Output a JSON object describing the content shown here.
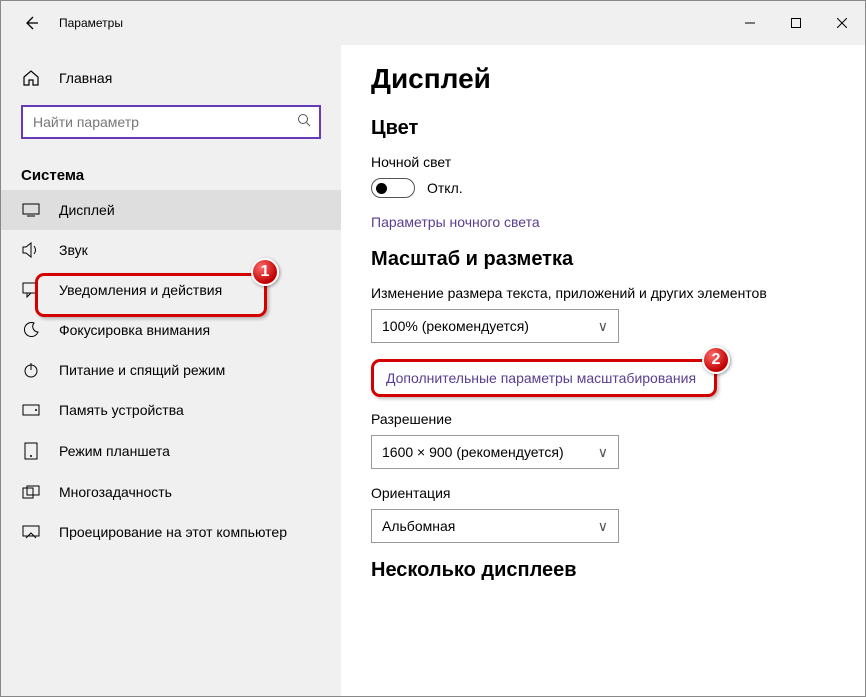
{
  "titlebar": {
    "title": "Параметры"
  },
  "sidebar": {
    "home": "Главная",
    "search_placeholder": "Найти параметр",
    "section": "Система",
    "items": [
      {
        "label": "Дисплей"
      },
      {
        "label": "Звук"
      },
      {
        "label": "Уведомления и действия"
      },
      {
        "label": "Фокусировка внимания"
      },
      {
        "label": "Питание и спящий режим"
      },
      {
        "label": "Память устройства"
      },
      {
        "label": "Режим планшета"
      },
      {
        "label": "Многозадачность"
      },
      {
        "label": "Проецирование на этот компьютер"
      }
    ]
  },
  "main": {
    "heading": "Дисплей",
    "color_heading": "Цвет",
    "night_light_label": "Ночной свет",
    "night_light_state": "Откл.",
    "night_light_link": "Параметры ночного света",
    "scale_heading": "Масштаб и разметка",
    "scale_label": "Изменение размера текста, приложений и других элементов",
    "scale_value": "100% (рекомендуется)",
    "advanced_scaling_link": "Дополнительные параметры масштабирования",
    "resolution_label": "Разрешение",
    "resolution_value": "1600 × 900 (рекомендуется)",
    "orientation_label": "Ориентация",
    "orientation_value": "Альбомная",
    "multi_heading": "Несколько дисплеев"
  },
  "annotations": {
    "badge1": "1",
    "badge2": "2"
  }
}
